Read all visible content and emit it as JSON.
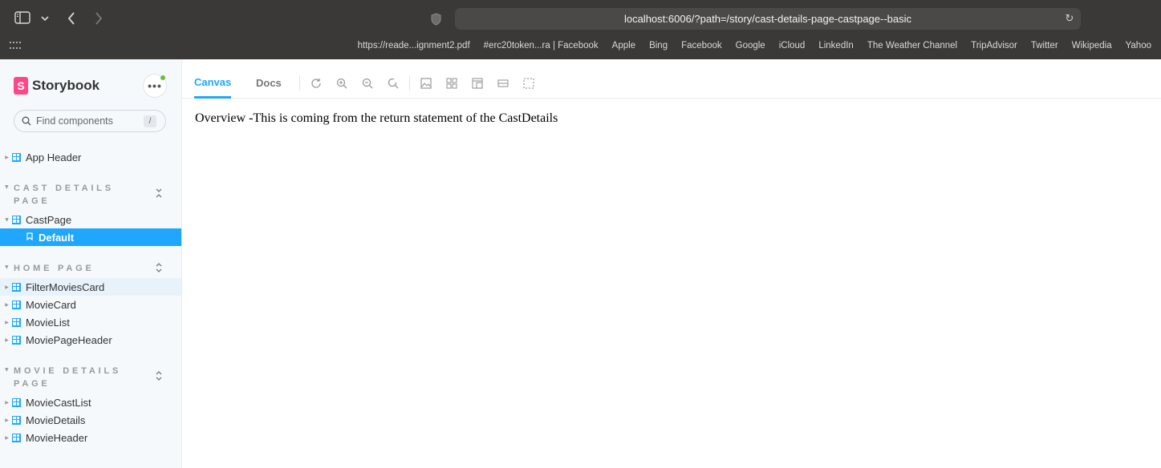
{
  "browser": {
    "url": "localhost:6006/?path=/story/cast-details-page-castpage--basic",
    "bookmarks": [
      "https://reade...ignment2.pdf",
      "#erc20token...ra | Facebook",
      "Apple",
      "Bing",
      "Facebook",
      "Google",
      "iCloud",
      "LinkedIn",
      "The Weather Channel",
      "TripAdvisor",
      "Twitter",
      "Wikipedia",
      "Yahoo"
    ]
  },
  "sidebar": {
    "brand": "Storybook",
    "brand_letter": "S",
    "menu_label": "•••",
    "search_placeholder": "Find components",
    "search_shortcut": "/",
    "top_items": [
      {
        "label": "App Header"
      }
    ],
    "groups": [
      {
        "title": "CAST DETAILS PAGE",
        "items": [
          {
            "label": "CastPage"
          }
        ],
        "stories": [
          {
            "label": "Default",
            "selected": true
          }
        ]
      },
      {
        "title": "HOME PAGE",
        "items": [
          {
            "label": "FilterMoviesCard"
          },
          {
            "label": "MovieCard"
          },
          {
            "label": "MovieList"
          },
          {
            "label": "MoviePageHeader"
          }
        ]
      },
      {
        "title": "MOVIE DETAILS PAGE",
        "items": [
          {
            "label": "MovieCastList"
          },
          {
            "label": "MovieDetails"
          },
          {
            "label": "MovieHeader"
          }
        ]
      }
    ]
  },
  "main": {
    "tabs": [
      {
        "label": "Canvas",
        "active": true
      },
      {
        "label": "Docs",
        "active": false
      }
    ],
    "tools": [
      "reload-icon",
      "zoom-in-icon",
      "zoom-out-icon",
      "zoom-reset-icon",
      "background-icon",
      "grid-icon",
      "viewport-icon",
      "measure-icon",
      "outline-icon"
    ],
    "canvas_text": "Overview -This is coming from the return statement of the CastDetails"
  },
  "colors": {
    "accent": "#1ea7fd",
    "brand": "#ff4785",
    "chrome_bg": "#3a3938",
    "status_dot": "#66bf3c"
  }
}
